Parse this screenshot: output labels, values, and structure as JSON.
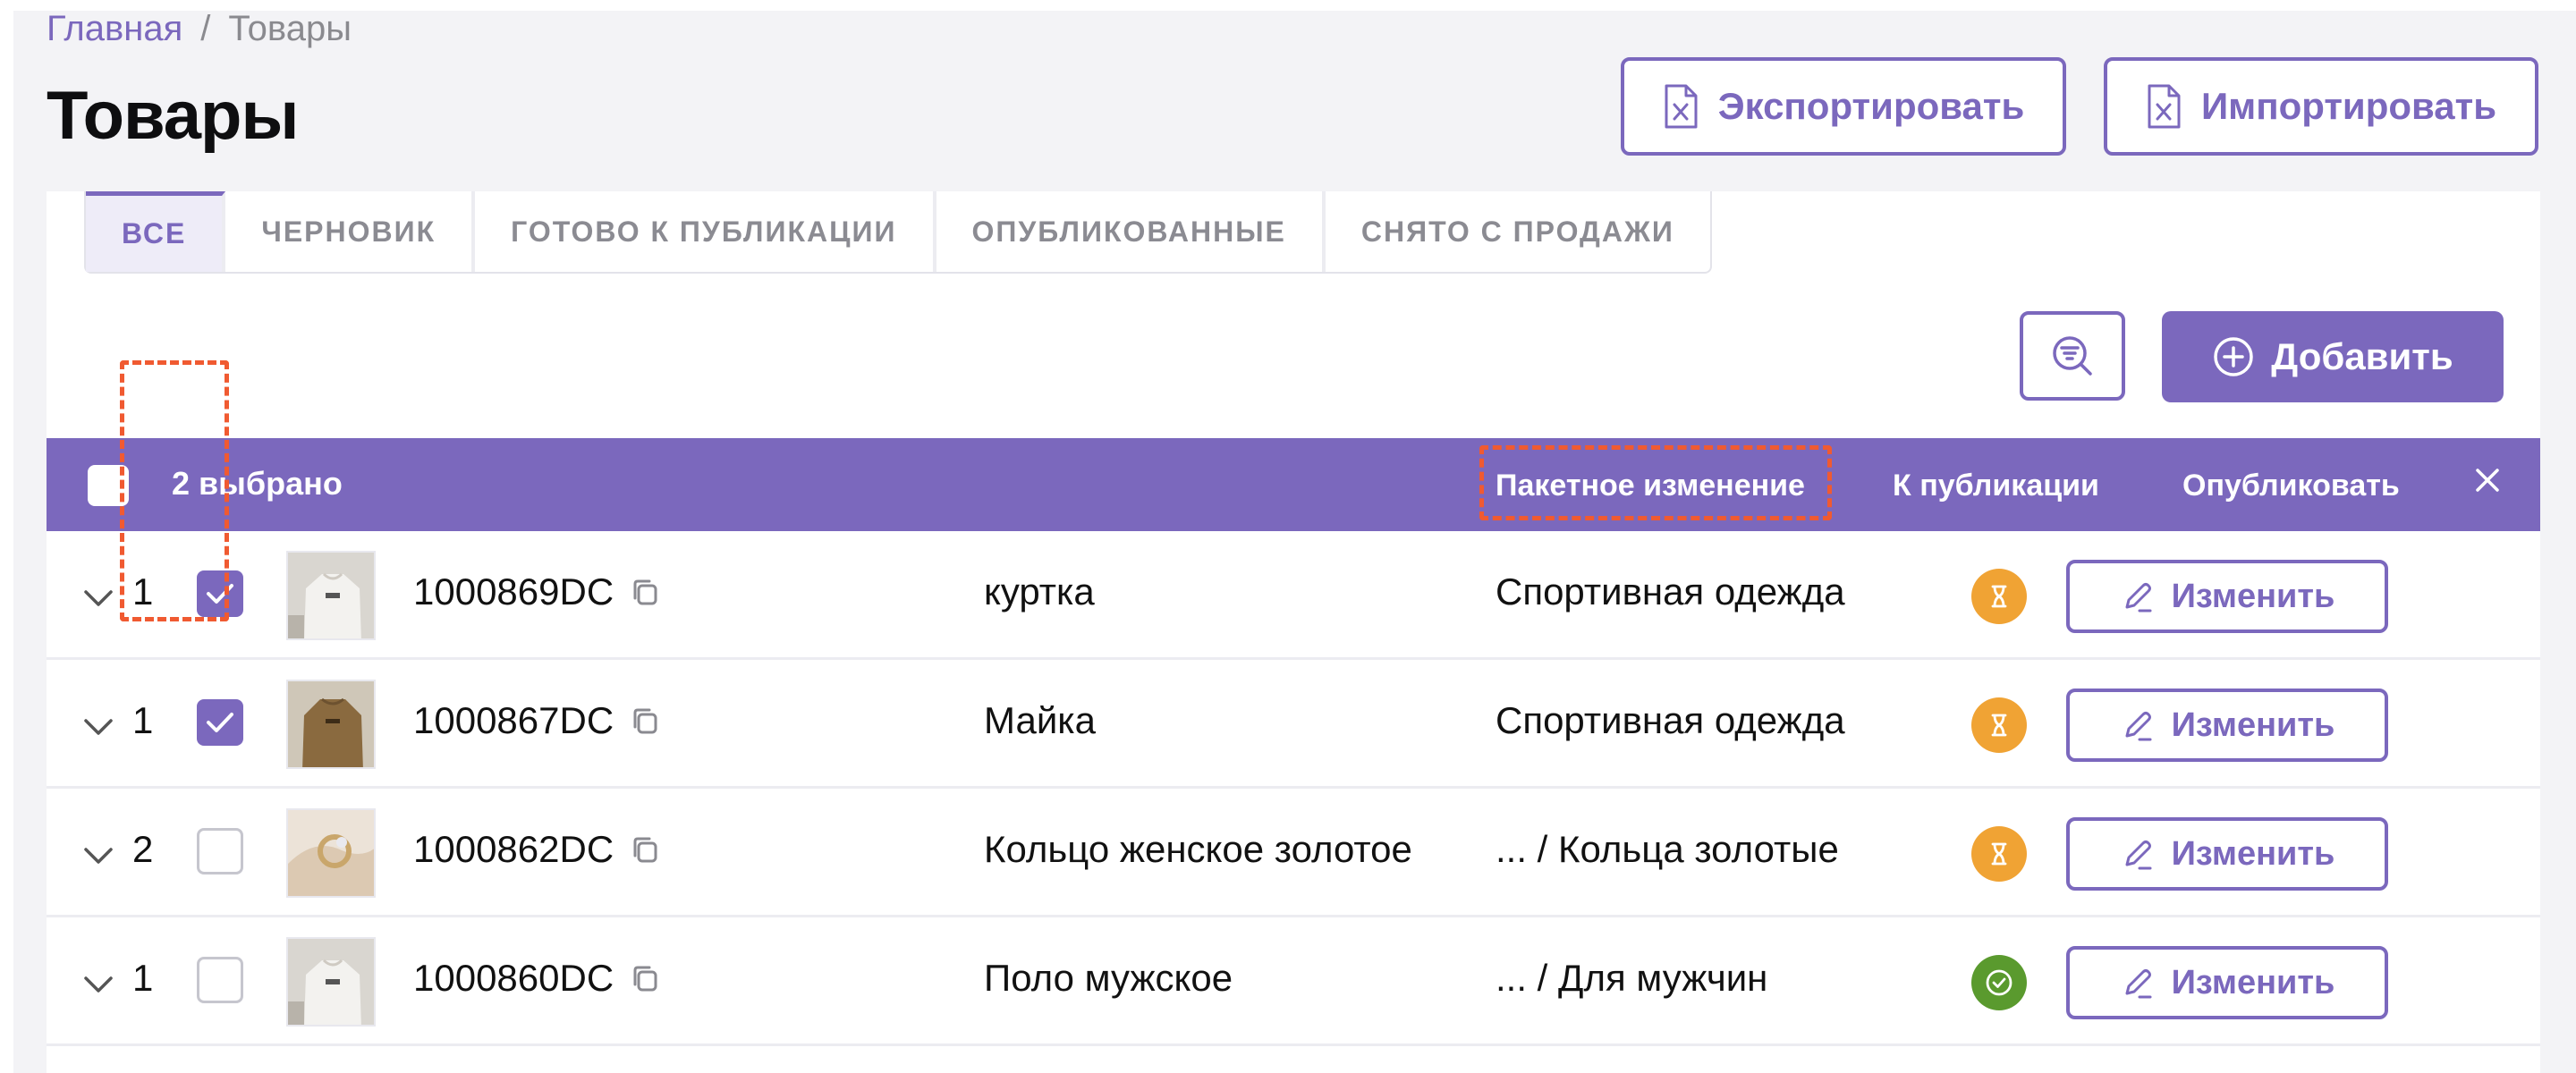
{
  "breadcrumb": {
    "home": "Главная",
    "separator": "/",
    "current": "Товары"
  },
  "page_title": "Товары",
  "header_buttons": {
    "export": "Экспортировать",
    "import": "Импортировать"
  },
  "tabs": [
    {
      "label": "ВСЕ",
      "active": true
    },
    {
      "label": "ЧЕРНОВИК",
      "active": false
    },
    {
      "label": "ГОТОВО К ПУБЛИКАЦИИ",
      "active": false
    },
    {
      "label": "ОПУБЛИКОВАННЫЕ",
      "active": false
    },
    {
      "label": "СНЯТО С ПРОДАЖИ",
      "active": false
    }
  ],
  "add_button": "Добавить",
  "bulk_bar": {
    "selected_text": "2 выбрано",
    "batch_edit": "Пакетное изменение",
    "to_publication": "К публикации",
    "publish": "Опубликовать"
  },
  "rows": [
    {
      "count": "1",
      "checked": true,
      "sku": "1000869DC",
      "name": "куртка",
      "category": "Спортивная одежда",
      "status": "pending",
      "edit": "Изменить"
    },
    {
      "count": "1",
      "checked": true,
      "sku": "1000867DC",
      "name": "Майка",
      "category": "Спортивная одежда",
      "status": "pending",
      "edit": "Изменить"
    },
    {
      "count": "2",
      "checked": false,
      "sku": "1000862DC",
      "name": "Кольцо женское золотое",
      "category": "... / Кольца золотые",
      "status": "pending",
      "edit": "Изменить"
    },
    {
      "count": "1",
      "checked": false,
      "sku": "1000860DC",
      "name": "Поло мужское",
      "category": "... / Для мужчин",
      "status": "ok",
      "edit": "Изменить"
    }
  ],
  "colors": {
    "accent": "#7b68bd",
    "highlight": "#f05a31",
    "status_pending": "#f0a334",
    "status_ok": "#5a9a2e"
  },
  "icons": [
    "excel-file-icon",
    "filter-search-icon",
    "plus-circle-icon",
    "close-icon",
    "chevron-down-icon",
    "copy-icon",
    "hourglass-icon",
    "check-circle-icon",
    "pencil-icon",
    "checkmark-icon"
  ]
}
